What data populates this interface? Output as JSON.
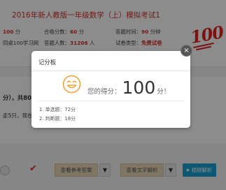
{
  "exam": {
    "title": "2016年新人教版一年级数学（上）模拟考试1",
    "total_score_value": "100",
    "total_score_unit": "分",
    "pass_label": "合格分数：",
    "pass_value": "60",
    "pass_unit": "分",
    "time_label": "答题时间：",
    "time_value": "90",
    "time_unit": "分钟",
    "source": "同桌100学习网",
    "participants_label": "答题人数：",
    "participants_value": "31206",
    "participants_unit": "人",
    "type_label": "试卷类型：",
    "type_value": "免费试卷",
    "stamp": "100"
  },
  "section": {
    "heading": "分），共80分）",
    "snippet": "走5只，现在树…"
  },
  "actions": {
    "answer_button": "查看参考答案",
    "explain_button": "查看文字解析",
    "video_button": "视频解析",
    "arrow": "▼",
    "check": "✔"
  },
  "modal": {
    "title": "记分板",
    "score_label": "您的得分：",
    "score_value": "100",
    "score_unit": "分！",
    "details": [
      "1. 单选题：72分",
      "2. 判断题：18分"
    ],
    "close": "×"
  }
}
